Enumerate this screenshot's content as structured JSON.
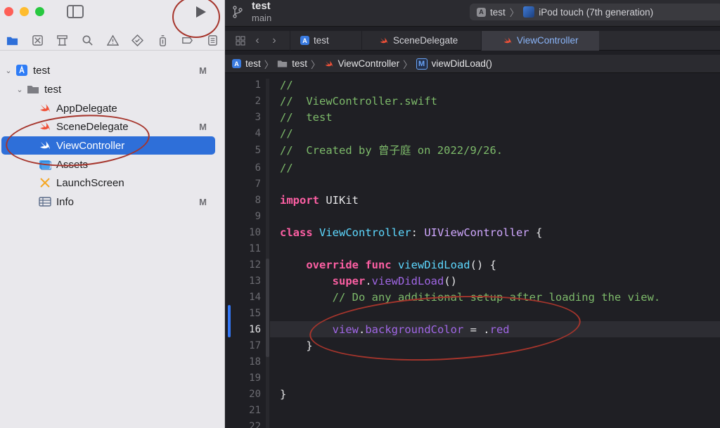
{
  "window": {
    "project": "test",
    "branch": "main"
  },
  "scheme": {
    "target": "test",
    "device": "iPod touch (7th generation)"
  },
  "tabs": [
    {
      "label": "test",
      "icon": "app-icon"
    },
    {
      "label": "SceneDelegate",
      "icon": "swift-icon"
    },
    {
      "label": "ViewController",
      "icon": "swift-icon",
      "active": true
    }
  ],
  "jumpbar": [
    "test",
    "test",
    "ViewController",
    "viewDidLoad()"
  ],
  "navigator": {
    "items": [
      {
        "label": "test",
        "badge": "M",
        "icon": "xcode-project-icon"
      },
      {
        "label": "test",
        "badge": "",
        "icon": "folder-icon"
      },
      {
        "label": "AppDelegate",
        "badge": "",
        "icon": "swift-icon"
      },
      {
        "label": "SceneDelegate",
        "badge": "M",
        "icon": "swift-icon"
      },
      {
        "label": "ViewController",
        "badge": "",
        "icon": "swift-icon",
        "selected": true
      },
      {
        "label": "Assets",
        "badge": "",
        "icon": "assets-icon"
      },
      {
        "label": "LaunchScreen",
        "badge": "",
        "icon": "storyboard-icon"
      },
      {
        "label": "Info",
        "badge": "M",
        "icon": "table-icon"
      }
    ]
  },
  "code": {
    "current_line": "16",
    "lines": [
      {
        "n": "1",
        "text": "//"
      },
      {
        "n": "2",
        "text": "//  ViewController.swift"
      },
      {
        "n": "3",
        "text": "//  test"
      },
      {
        "n": "4",
        "text": "//"
      },
      {
        "n": "5",
        "text": "//  Created by 曾子庭 on 2022/9/26."
      },
      {
        "n": "6",
        "text": "//"
      },
      {
        "n": "7",
        "text": ""
      },
      {
        "n": "8",
        "kw": "import",
        "rest": " UIKit"
      },
      {
        "n": "9",
        "text": ""
      },
      {
        "n": "10",
        "kw": "class",
        "name": " ViewController",
        "colon": ": ",
        "super": "UIViewController",
        "tail": " {"
      },
      {
        "n": "11",
        "text": ""
      },
      {
        "n": "12",
        "kw": "    override func",
        "fn": " viewDidLoad",
        "tail": "() {"
      },
      {
        "n": "13",
        "kw": "        super",
        "dot": ".",
        "fn": "viewDidLoad",
        "tail": "()"
      },
      {
        "n": "14",
        "text": "        // Do any additional setup after loading the view."
      },
      {
        "n": "15",
        "text": ""
      },
      {
        "n": "16",
        "a": "        view",
        "b": ".",
        "c": "backgroundColor",
        "d": " = .",
        "e": "red"
      },
      {
        "n": "17",
        "text": "    }"
      },
      {
        "n": "18",
        "text": ""
      },
      {
        "n": "19",
        "text": ""
      },
      {
        "n": "20",
        "text": "}"
      },
      {
        "n": "21",
        "text": ""
      },
      {
        "n": "22",
        "text": ""
      }
    ]
  },
  "colors": {
    "accent": "#2e6fd9",
    "annotation": "#a6352c",
    "comment": "#7dba6a",
    "keyword": "#fc5fa3"
  }
}
